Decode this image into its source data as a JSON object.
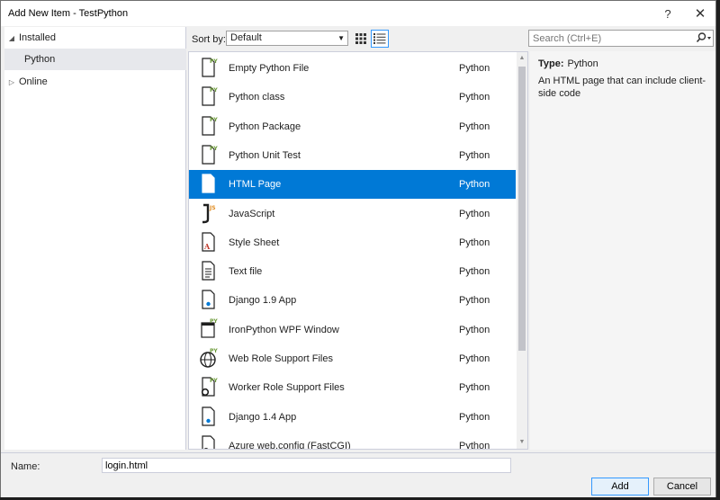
{
  "window": {
    "title": "Add New Item - TestPython",
    "help": "?",
    "close": "✕"
  },
  "tree": {
    "installed": "Installed",
    "python": "Python",
    "online": "Online"
  },
  "toolbar": {
    "sort_label": "Sort by:",
    "sort_value": "Default",
    "search_placeholder": "Search (Ctrl+E)"
  },
  "items": [
    {
      "name": "Empty Python File",
      "lang": "Python",
      "icon": "python-file-icon"
    },
    {
      "name": "Python class",
      "lang": "Python",
      "icon": "python-file-icon"
    },
    {
      "name": "Python Package",
      "lang": "Python",
      "icon": "python-file-icon"
    },
    {
      "name": "Python Unit Test",
      "lang": "Python",
      "icon": "python-file-icon"
    },
    {
      "name": "HTML Page",
      "lang": "Python",
      "icon": "html-file-icon"
    },
    {
      "name": "JavaScript",
      "lang": "Python",
      "icon": "javascript-file-icon"
    },
    {
      "name": "Style Sheet",
      "lang": "Python",
      "icon": "stylesheet-file-icon"
    },
    {
      "name": "Text file",
      "lang": "Python",
      "icon": "text-file-icon"
    },
    {
      "name": "Django 1.9 App",
      "lang": "Python",
      "icon": "django-app-icon"
    },
    {
      "name": "IronPython WPF Window",
      "lang": "Python",
      "icon": "wpf-window-icon"
    },
    {
      "name": "Web Role Support Files",
      "lang": "Python",
      "icon": "globe-icon"
    },
    {
      "name": "Worker Role Support Files",
      "lang": "Python",
      "icon": "gear-file-icon"
    },
    {
      "name": "Django 1.4 App",
      "lang": "Python",
      "icon": "django-app-icon"
    },
    {
      "name": "Azure web.config (FastCGI)",
      "lang": "Python",
      "icon": "config-file-icon"
    }
  ],
  "selected_index": 4,
  "details": {
    "type_label": "Type:",
    "type_value": "Python",
    "description": "An HTML page that can include client-side code"
  },
  "bottom": {
    "name_label": "Name:",
    "name_value": "login.html",
    "add_label": "Add",
    "cancel_label": "Cancel"
  },
  "colors": {
    "selection": "#0079d6",
    "python_badge": "#6d9b3a",
    "js_badge": "#e08a1e"
  }
}
